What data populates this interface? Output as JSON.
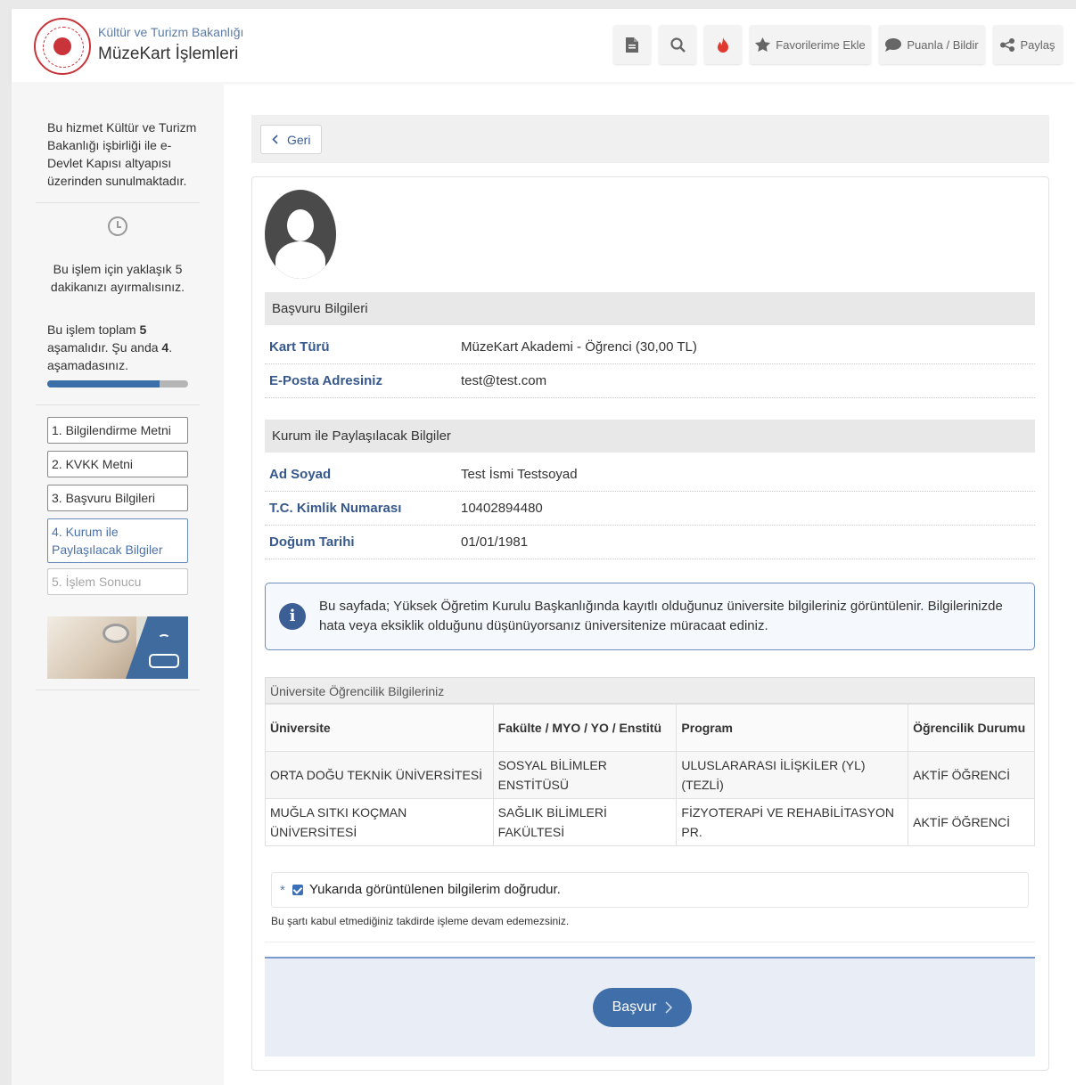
{
  "header": {
    "ministry": "Kültür ve Turizm Bakanlığı",
    "title": "MüzeKart İşlemleri",
    "buttons": {
      "favorites": "Favorilerime Ekle",
      "rate": "Puanla / Bildir",
      "share": "Paylaş"
    },
    "icons": [
      "document-icon",
      "search-icon",
      "fire-icon",
      "star-icon",
      "comment-icon",
      "share-icon"
    ]
  },
  "sidebar": {
    "intro": "Bu hizmet Kültür ve Turizm Bakanlığı işbirliği ile e-Devlet Kapısı altyapısı üzerinden sunulmaktadır.",
    "time": "Bu işlem için yaklaşık 5 dakikanızı ayırmalısınız.",
    "steps_pre": "Bu işlem toplam ",
    "steps_total": "5",
    "steps_mid": " aşamalıdır. Şu anda ",
    "steps_current": "4",
    "steps_post": ". aşamadasınız.",
    "progress_fraction": 0.8,
    "items": [
      {
        "label": "1. Bilgilendirme Metni",
        "state": "done"
      },
      {
        "label": "2. KVKK Metni",
        "state": "done"
      },
      {
        "label": "3. Başvuru Bilgileri",
        "state": "done"
      },
      {
        "label": "4. Kurum ile Paylaşılacak Bilgiler",
        "state": "active"
      },
      {
        "label": "5. İşlem Sonucu",
        "state": "disabled"
      }
    ]
  },
  "main": {
    "back_label": "Geri",
    "application": {
      "heading": "Başvuru Bilgileri",
      "rows": [
        {
          "label": "Kart Türü",
          "value": "MüzeKart Akademi - Öğrenci (30,00 TL)"
        },
        {
          "label": "E-Posta Adresiniz",
          "value": "test@test.com"
        }
      ]
    },
    "shared": {
      "heading": "Kurum ile Paylaşılacak Bilgiler",
      "rows": [
        {
          "label": "Ad Soyad",
          "value": "Test İsmi Testsoyad"
        },
        {
          "label": "T.C. Kimlik Numarası",
          "value": "10402894480"
        },
        {
          "label": "Doğum Tarihi",
          "value": "01/01/1981"
        }
      ]
    },
    "info": "Bu sayfada; Yüksek Öğretim Kurulu Başkanlığında kayıtlı olduğunuz üniversite bilgileriniz görüntülenir. Bilgilerinizde hata veya eksiklik olduğunu düşünüyorsanız üniversitenize müracaat ediniz.",
    "university": {
      "title": "Üniversite Öğrencilik Bilgileriniz",
      "columns": [
        "Üniversite",
        "Fakülte / MYO / YO / Enstitü",
        "Program",
        "Öğrencilik Durumu"
      ],
      "rows": [
        [
          "ORTA DOĞU TEKNİK ÜNİVERSİTESİ",
          "SOSYAL BİLİMLER ENSTİTÜSÜ",
          "ULUSLARARASI İLİŞKİLER (YL) (TEZLİ)",
          "AKTİF ÖĞRENCİ"
        ],
        [
          "MUĞLA SITKI KOÇMAN ÜNİVERSİTESİ",
          "SAĞLIK BİLİMLERİ FAKÜLTESİ",
          "FİZYOTERAPİ VE REHABİLİTASYON PR.",
          "AKTİF ÖĞRENCİ"
        ]
      ]
    },
    "agree": {
      "required_mark": "*",
      "label": "Yukarıda görüntülenen bilgilerim doğrudur.",
      "checked": true,
      "note": "Bu şartı kabul etmediğiniz takdirde işleme devam edemezsiniz."
    },
    "submit_label": "Başvur"
  },
  "colors": {
    "accent": "#3f6ea9",
    "label_blue": "#36588c",
    "emblem_red": "#c8343a"
  }
}
